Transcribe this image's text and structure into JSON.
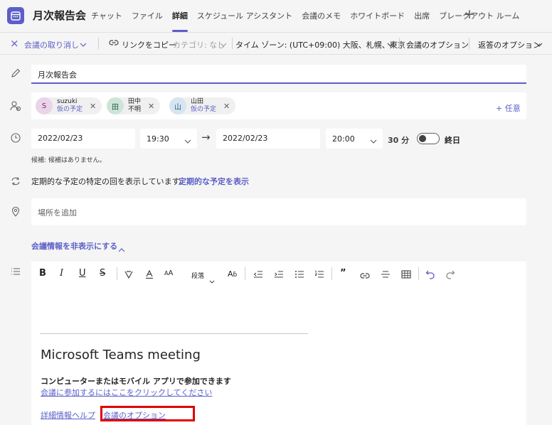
{
  "header": {
    "title": "月次報告会",
    "tabs": [
      "チャット",
      "ファイル",
      "詳細",
      "スケジュール アシスタント",
      "会議のメモ",
      "ホワイトボード",
      "出席",
      "ブレークアウト ルーム"
    ],
    "active_tab": "詳細",
    "add_tab_icon": "plus-icon"
  },
  "toolbar": {
    "cancel_label": "会議の取り消し",
    "copy_link_label": "リンクをコピー",
    "category_label": "カテゴリ: なし",
    "timezone_label": "タイム ゾーン: (UTC+09:00) 大阪、札幌、東京",
    "meeting_options_label": "会議のオプション",
    "response_options_label": "返答のオプション"
  },
  "form": {
    "title_value": "月次報告会",
    "attendees": [
      {
        "initial": "S",
        "name": "suzuki",
        "status": "仮の予定",
        "color": "#e9d4e9",
        "text_color": "#7a2a6b"
      },
      {
        "initial": "田",
        "name": "田中",
        "status": "不明",
        "color": "#cfe4d9",
        "text_color": "#1e5c3c"
      },
      {
        "initial": "山",
        "name": "山田",
        "status": "仮の予定",
        "color": "#d6e5f1",
        "text_color": "#2b5f8a"
      }
    ],
    "optional_label": "+ 任意",
    "start_date": "2022/02/23",
    "start_time": "19:30",
    "arrow": "→",
    "end_date": "2022/02/23",
    "end_time": "20:00",
    "duration": "30 分",
    "all_day_label": "終日",
    "suggestion_text": "候補: 候補はありません。",
    "recurrence_text": "定期的な予定の特定の回を表示しています。",
    "recurrence_link": "定期的な予定を表示",
    "location_placeholder": "場所を追加",
    "hide_info_label": "会議情報を非表示にする"
  },
  "editor": {
    "paragraph_label": "段落",
    "meeting_heading": "Microsoft Teams meeting",
    "join_heading": "コンピューターまたはモバイル アプリで参加できます",
    "join_link": "会議に参加するにはここをクリックしてください",
    "help_link": "詳細情報ヘルプ",
    "options_link": "会議のオプション"
  },
  "colors": {
    "accent": "#5b5fc7",
    "highlight": "#e00000"
  }
}
